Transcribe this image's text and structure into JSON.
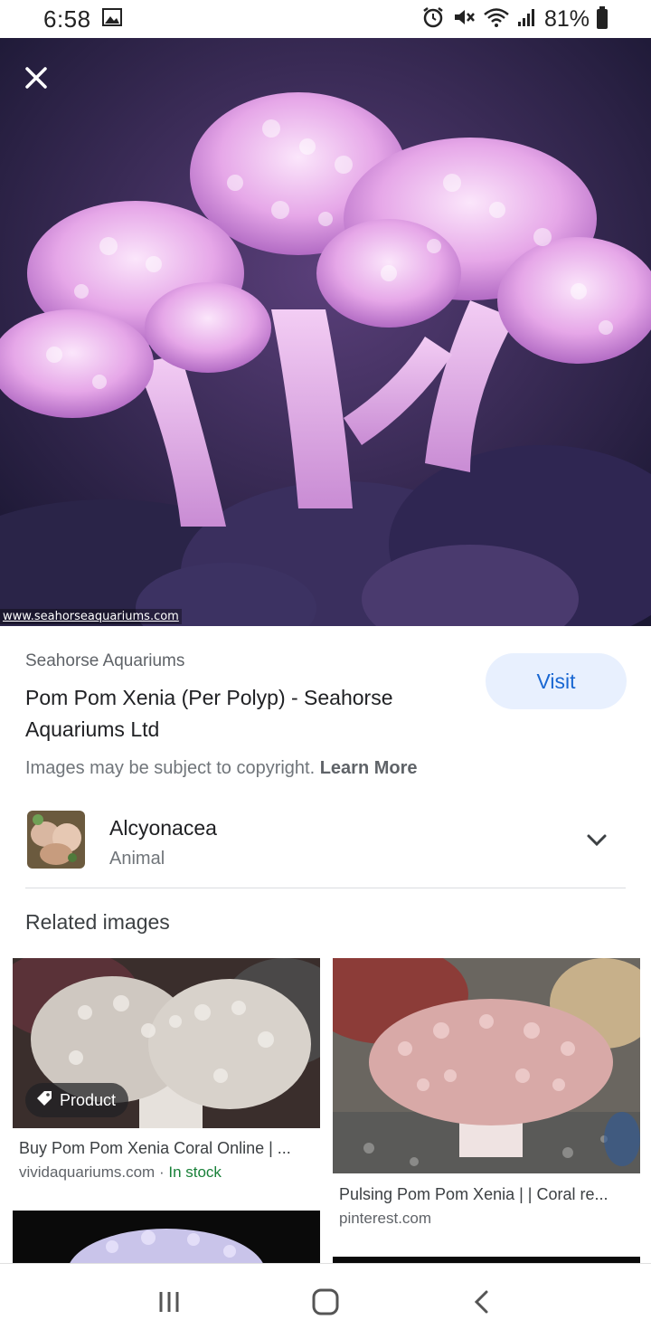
{
  "status_bar": {
    "time": "6:58",
    "battery": "81%",
    "icons": [
      "gallery-icon",
      "alarm-icon",
      "mute-icon",
      "wifi-icon",
      "signal-icon",
      "battery-icon"
    ]
  },
  "hero": {
    "watermark": "www.seahorseaquariums.com",
    "close_icon": "close-icon"
  },
  "result": {
    "source": "Seahorse Aquariums",
    "title": "Pom Pom Xenia (Per Polyp) - Seahorse Aquariums Ltd",
    "visit_label": "Visit",
    "copyright_text": "Images may be subject to copyright.",
    "learn_more": "Learn More"
  },
  "entity": {
    "name": "Alcyonacea",
    "type": "Animal",
    "chevron": "chevron-down-icon"
  },
  "related": {
    "heading": "Related images",
    "items": [
      {
        "title": "Buy Pom Pom Xenia Coral Online | ...",
        "source": "vividaquariums.com",
        "separator": " · ",
        "status": "In stock",
        "chip": "Product"
      },
      {
        "title": "Pulsing Pom Pom Xenia | | Coral re...",
        "source": "pinterest.com"
      }
    ]
  },
  "nav": {
    "recents": "recents-icon",
    "home": "home-icon",
    "back": "back-icon"
  },
  "colors": {
    "accent": "#1967d2",
    "visit_bg": "#e8f0fe",
    "in_stock": "#188038"
  }
}
